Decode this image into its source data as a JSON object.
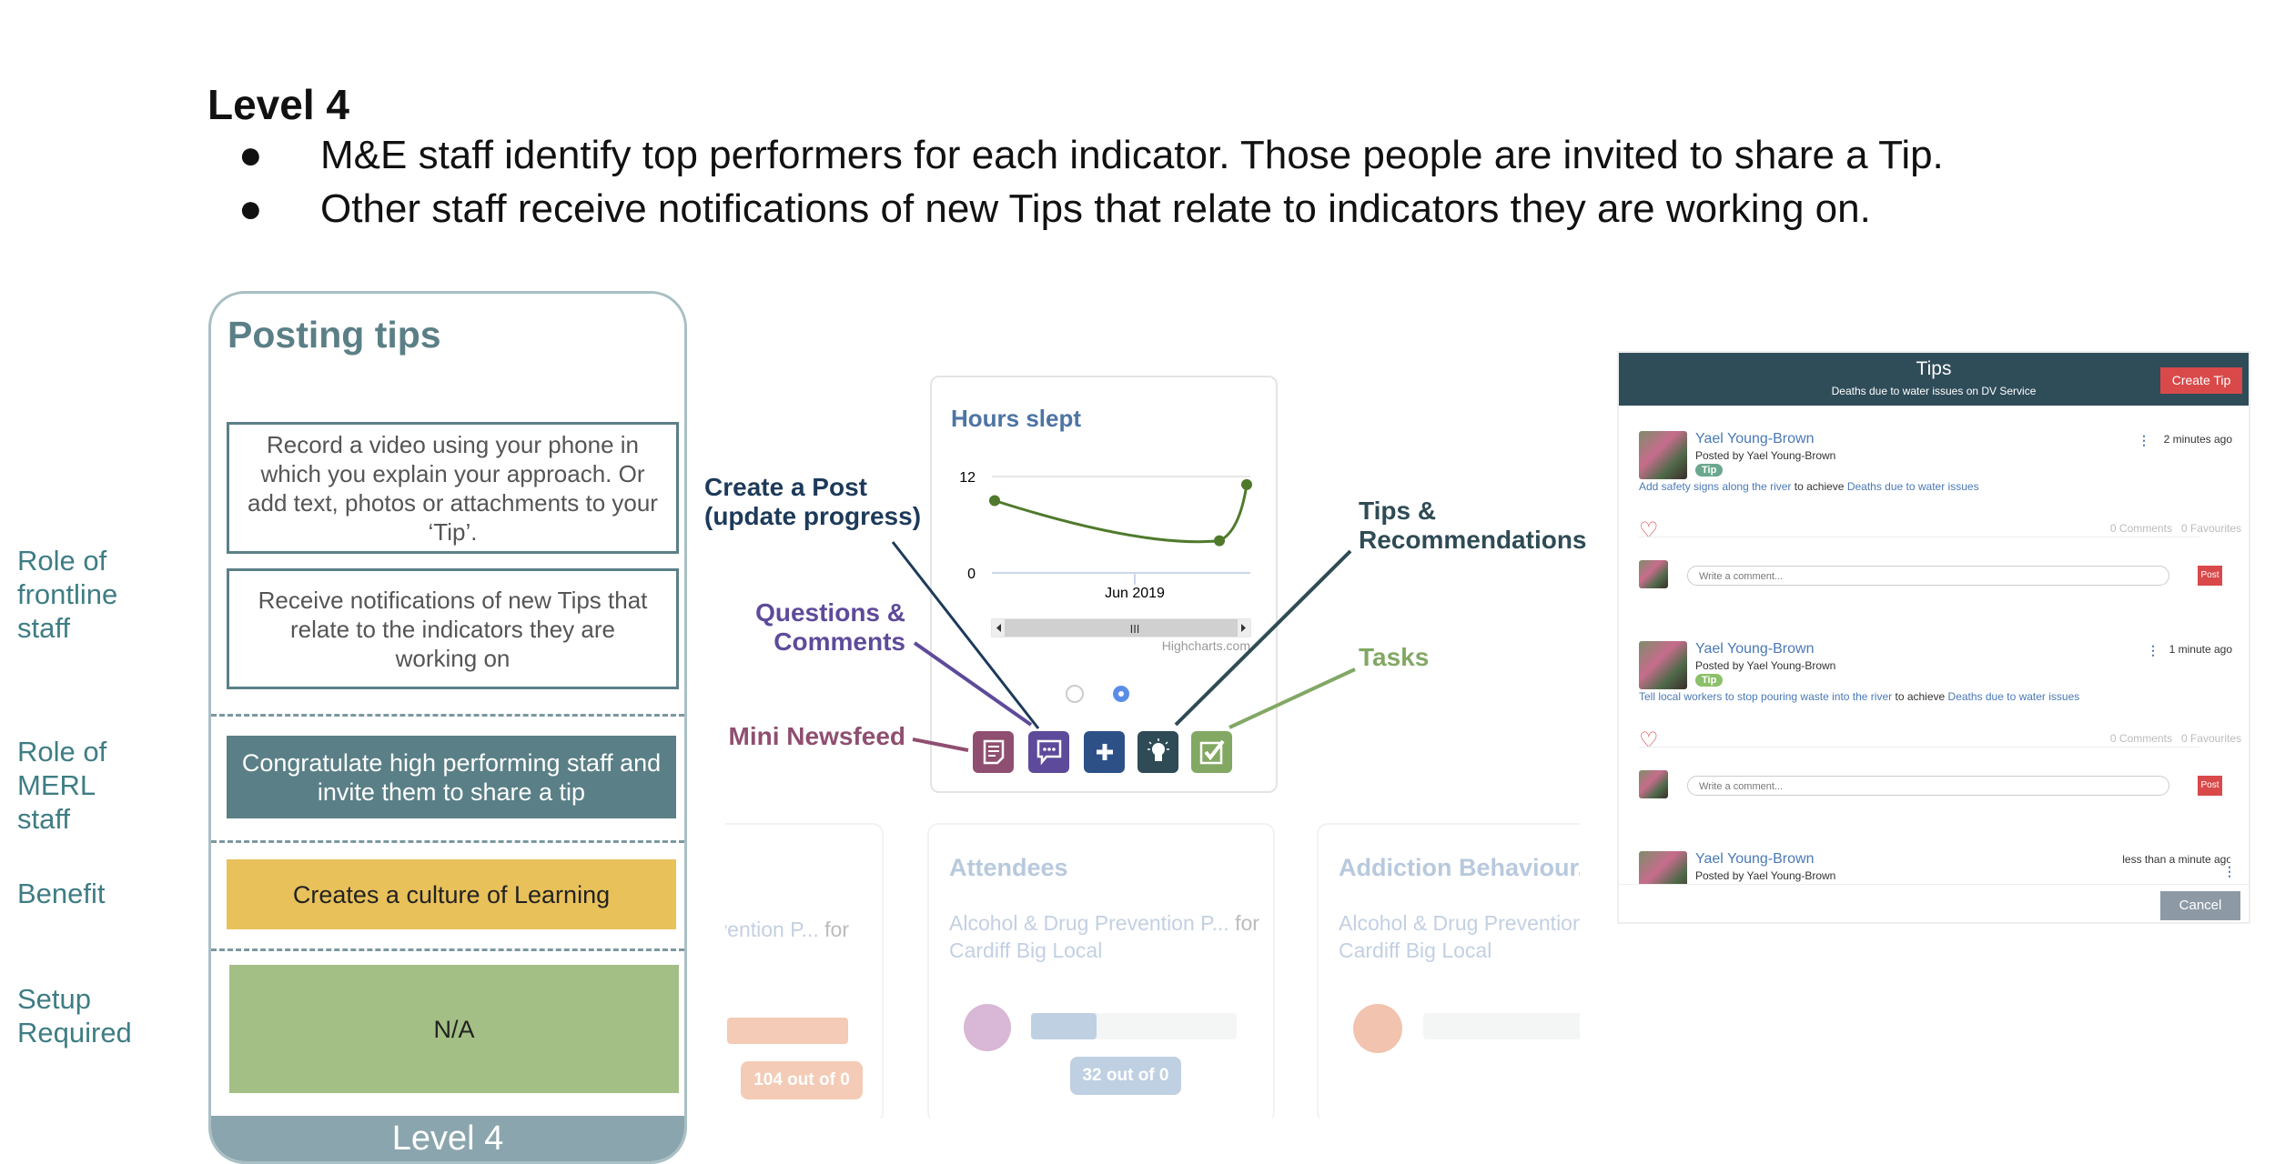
{
  "heading": "Level 4",
  "bullets": [
    "M&E staff identify top performers for each indicator. Those people are invited to share a Tip.",
    "Other staff receive notifications of new Tips that relate to indicators they are working on."
  ],
  "bullet_glyph": "●",
  "role_labels": {
    "frontline": "Role of frontline staff",
    "merl": "Role of MERL staff",
    "benefit": "Benefit",
    "setup": "Setup Required"
  },
  "left_card": {
    "title": "Posting tips",
    "box1": "Record a video using your phone in which you explain your approach. Or add text, photos or attachments to your ‘Tip’.",
    "box2": "Receive notifications of new Tips that relate to the indicators they are working on",
    "merl": "Congratulate high performing staff and invite them to share a tip",
    "benefit": "Creates a culture of Learning",
    "setup": "N/A",
    "footer": "Level 4",
    "colors": {
      "merl": "#5a7f86",
      "benefit": "#e8c15a",
      "setup": "#a3bf85",
      "footer": "#8aa5ad"
    }
  },
  "chart_card": {
    "title": "Hours slept",
    "credit": "Highcharts.com",
    "scroll_grip": "III"
  },
  "chart_data": {
    "type": "line",
    "title": "Hours slept",
    "y_ticks": [
      "0",
      "12"
    ],
    "x_ticks": [
      "Jun 2019"
    ],
    "ylim": [
      0,
      12
    ],
    "series": [
      {
        "values": [
          9,
          4,
          11
        ],
        "color": "#4f7a2c"
      }
    ],
    "grid": true
  },
  "icons": [
    {
      "name": "mini-newsfeed",
      "color": "#8f4f70"
    },
    {
      "name": "questions-comments",
      "color": "#5e4a9a"
    },
    {
      "name": "create-post",
      "color": "#2d5187"
    },
    {
      "name": "tips",
      "color": "#2f4b55"
    },
    {
      "name": "tasks",
      "color": "#82a864"
    }
  ],
  "annotations": {
    "create_post": [
      "Create a Post",
      "(update progress)"
    ],
    "questions": [
      "Questions &",
      "Comments"
    ],
    "newsfeed": "Mini Newsfeed",
    "tips": [
      "Tips &",
      "Recommendations"
    ],
    "tasks": "Tasks"
  },
  "indicator_cards": [
    {
      "title": "",
      "sub1": "vention P...",
      "for": "for",
      "sub2": "",
      "progress_label": "104 out of 0",
      "color": "#f4cbb6"
    },
    {
      "title": "Attendees",
      "sub1": "Alcohol & Drug Prevention P...",
      "for": "for",
      "sub2": "Cardiff Big Local",
      "progress_label": "32 out of 0",
      "color": "#bfd0e2"
    },
    {
      "title": "Addiction Behaviour.",
      "sub1": "Alcohol & Drug Prevention P",
      "for": "",
      "sub2": "Cardiff Big Local",
      "progress_label": "",
      "color": "#f2c3ae"
    }
  ],
  "tips_panel": {
    "title": "Tips",
    "subtitle": "Deaths due to water issues on DV Service",
    "create_button": "Create Tip",
    "cancel_button": "Cancel",
    "comment_placeholder": "Write a comment...",
    "post_button": "Post",
    "posts": [
      {
        "author": "Yael Young-Brown",
        "posted_by": "Posted by Yael Young-Brown",
        "badge": "Tip",
        "tip": "Add safety signs along the river",
        "to_achieve": "to achieve",
        "indicator": "Deaths due to water issues",
        "time": "2 minutes ago",
        "comments": "0 Comments",
        "favourites": "0 Favourites"
      },
      {
        "author": "Yael Young-Brown",
        "posted_by": "Posted by Yael Young-Brown",
        "badge": "Tip",
        "tip": "Tell local workers to stop pouring waste into the river",
        "to_achieve": "to achieve",
        "indicator": "Deaths due to water issues",
        "time": "1 minute ago",
        "comments": "0 Comments",
        "favourites": "0 Favourites"
      },
      {
        "author": "Yael Young-Brown",
        "posted_by": "Posted by Yael Young-Brown",
        "time": "less than a minute ago"
      }
    ]
  }
}
